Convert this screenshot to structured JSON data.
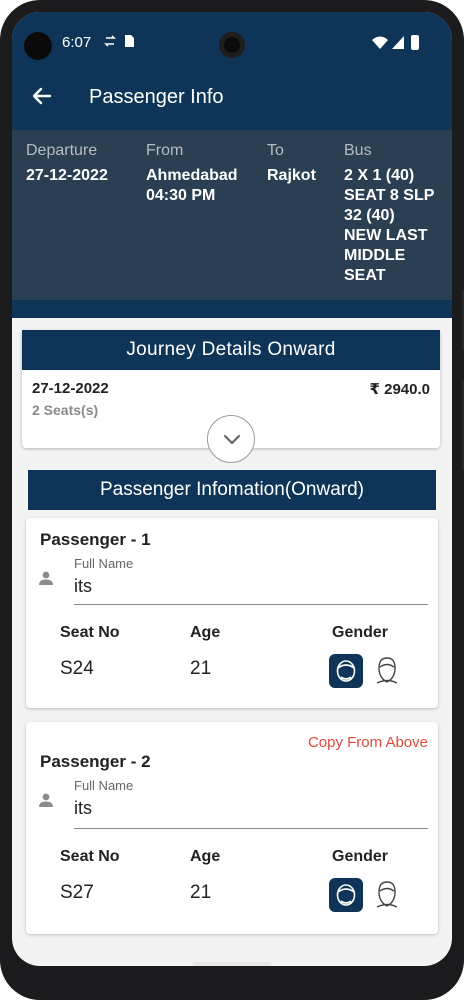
{
  "status_bar": {
    "time": "6:07"
  },
  "app_bar": {
    "title": "Passenger Info"
  },
  "trip_info": [
    {
      "label": "Departure",
      "value": "27-12-2022"
    },
    {
      "label": "From",
      "value": "Ahmedabad\n04:30 PM"
    },
    {
      "label": "To",
      "value": "Rajkot"
    },
    {
      "label": "Bus",
      "value": "2 X 1 (40)\nSEAT 8 SLP\n32 (40)\nNEW LAST\nMIDDLE\nSEAT"
    }
  ],
  "journey": {
    "header": "Journey Details Onward",
    "date": "27-12-2022",
    "seats": "2 Seats(s)",
    "price": "₹ 2940.0"
  },
  "passenger_section": {
    "header": "Passenger Infomation(Onward)"
  },
  "passengers": [
    {
      "title": "Passenger - 1",
      "full_name_label": "Full Name",
      "full_name": "its",
      "seat_label": "Seat No",
      "seat": "S24",
      "age_label": "Age",
      "age": "21",
      "gender_label": "Gender"
    },
    {
      "title": "Passenger - 2",
      "copy_label": "Copy From Above",
      "full_name_label": "Full Name",
      "full_name": "its",
      "seat_label": "Seat No",
      "seat": "S27",
      "age_label": "Age",
      "age": "21",
      "gender_label": "Gender"
    }
  ],
  "colors": {
    "primary": "#0e3557",
    "info_band": "#2b3f52",
    "accent_red": "#e04a3b"
  }
}
